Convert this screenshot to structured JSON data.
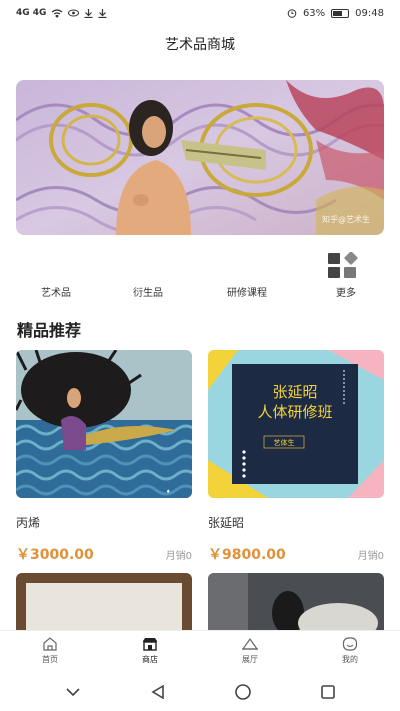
{
  "status_bar": {
    "signal_left": "4G 4G",
    "battery_percent": "63%",
    "battery_level": 0.63,
    "time": "09:48"
  },
  "app": {
    "title": "艺术品商城"
  },
  "banner": {
    "watermark": "知乎@艺术生",
    "slide_count": 3,
    "active_slide": 2
  },
  "categories": [
    {
      "label": "艺术品"
    },
    {
      "label": "衍生品"
    },
    {
      "label": "研修课程"
    },
    {
      "label": "更多"
    }
  ],
  "section": {
    "title": "精品推荐"
  },
  "products": [
    {
      "name": "丙烯",
      "price": "￥3000.00",
      "sales": "月销0"
    },
    {
      "name": "张延昭",
      "price": "￥9800.00",
      "sales": "月销0",
      "poster_title": "张延昭",
      "poster_subtitle": "人体研修班",
      "poster_tag": "艺体生"
    }
  ],
  "tabbar": [
    {
      "label": "首页",
      "icon": "home-icon"
    },
    {
      "label": "商店",
      "icon": "store-icon",
      "active": true
    },
    {
      "label": "展厅",
      "icon": "gallery-icon"
    },
    {
      "label": "我的",
      "icon": "profile-icon"
    }
  ],
  "colors": {
    "price": "#e0913a",
    "accent_yellow": "#f4d33a",
    "poster_navy": "#1d2a44"
  }
}
